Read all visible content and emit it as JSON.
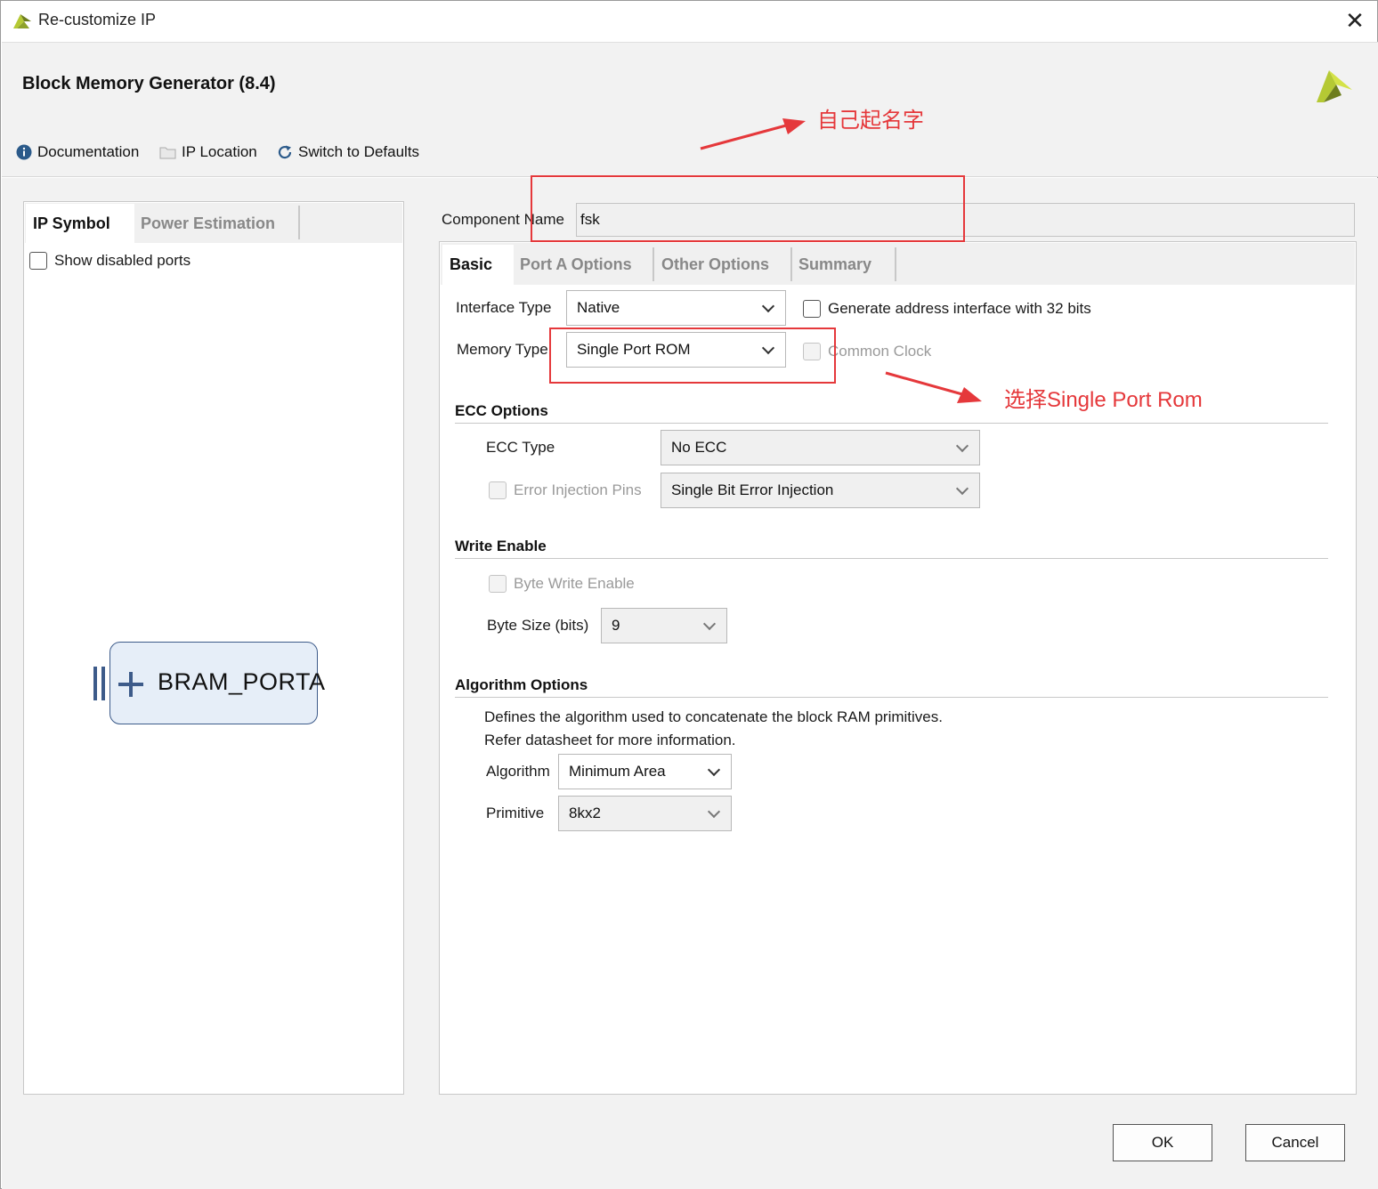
{
  "window": {
    "title": "Re-customize IP"
  },
  "header": {
    "title": "Block Memory Generator (8.4)",
    "toolbar": [
      {
        "label": "Documentation",
        "icon": "info-icon"
      },
      {
        "label": "IP Location",
        "icon": "folder-icon"
      },
      {
        "label": "Switch to Defaults",
        "icon": "refresh-icon"
      }
    ]
  },
  "left_panel": {
    "tabs": [
      "IP Symbol",
      "Power Estimation"
    ],
    "active_tab": "IP Symbol",
    "show_disabled_ports_label": "Show disabled ports",
    "symbol_port_label": "BRAM_PORTA"
  },
  "component": {
    "label": "Component Name",
    "value": "fsk"
  },
  "right_tabs": [
    "Basic",
    "Port A Options",
    "Other Options",
    "Summary"
  ],
  "active_right_tab": "Basic",
  "basic": {
    "interface_type_label": "Interface Type",
    "interface_type_value": "Native",
    "generate_addr_label": "Generate address interface with 32 bits",
    "memory_type_label": "Memory Type",
    "memory_type_value": "Single Port ROM",
    "common_clock_label": "Common Clock",
    "ecc": {
      "section": "ECC Options",
      "type_label": "ECC Type",
      "type_value": "No ECC",
      "injection_label": "Error Injection Pins",
      "injection_value": "Single Bit Error Injection"
    },
    "write_enable": {
      "section": "Write Enable",
      "byte_write_label": "Byte Write Enable",
      "byte_size_label": "Byte Size (bits)",
      "byte_size_value": "9"
    },
    "algorithm": {
      "section": "Algorithm Options",
      "desc1": "Defines the algorithm used to concatenate the block RAM primitives.",
      "desc2": "Refer datasheet for more information.",
      "algorithm_label": "Algorithm",
      "algorithm_value": "Minimum Area",
      "primitive_label": "Primitive",
      "primitive_value": "8kx2"
    }
  },
  "buttons": {
    "ok": "OK",
    "cancel": "Cancel"
  },
  "annotations": {
    "name_note": "自己起名字",
    "rom_note": "选择Single Port Rom",
    "color": "#e5383b"
  },
  "colors": {
    "vivado_logo_green": "#b5c934",
    "vivado_logo_dark": "#6d7d1e",
    "symbol_blue": "#3d5b8a"
  }
}
